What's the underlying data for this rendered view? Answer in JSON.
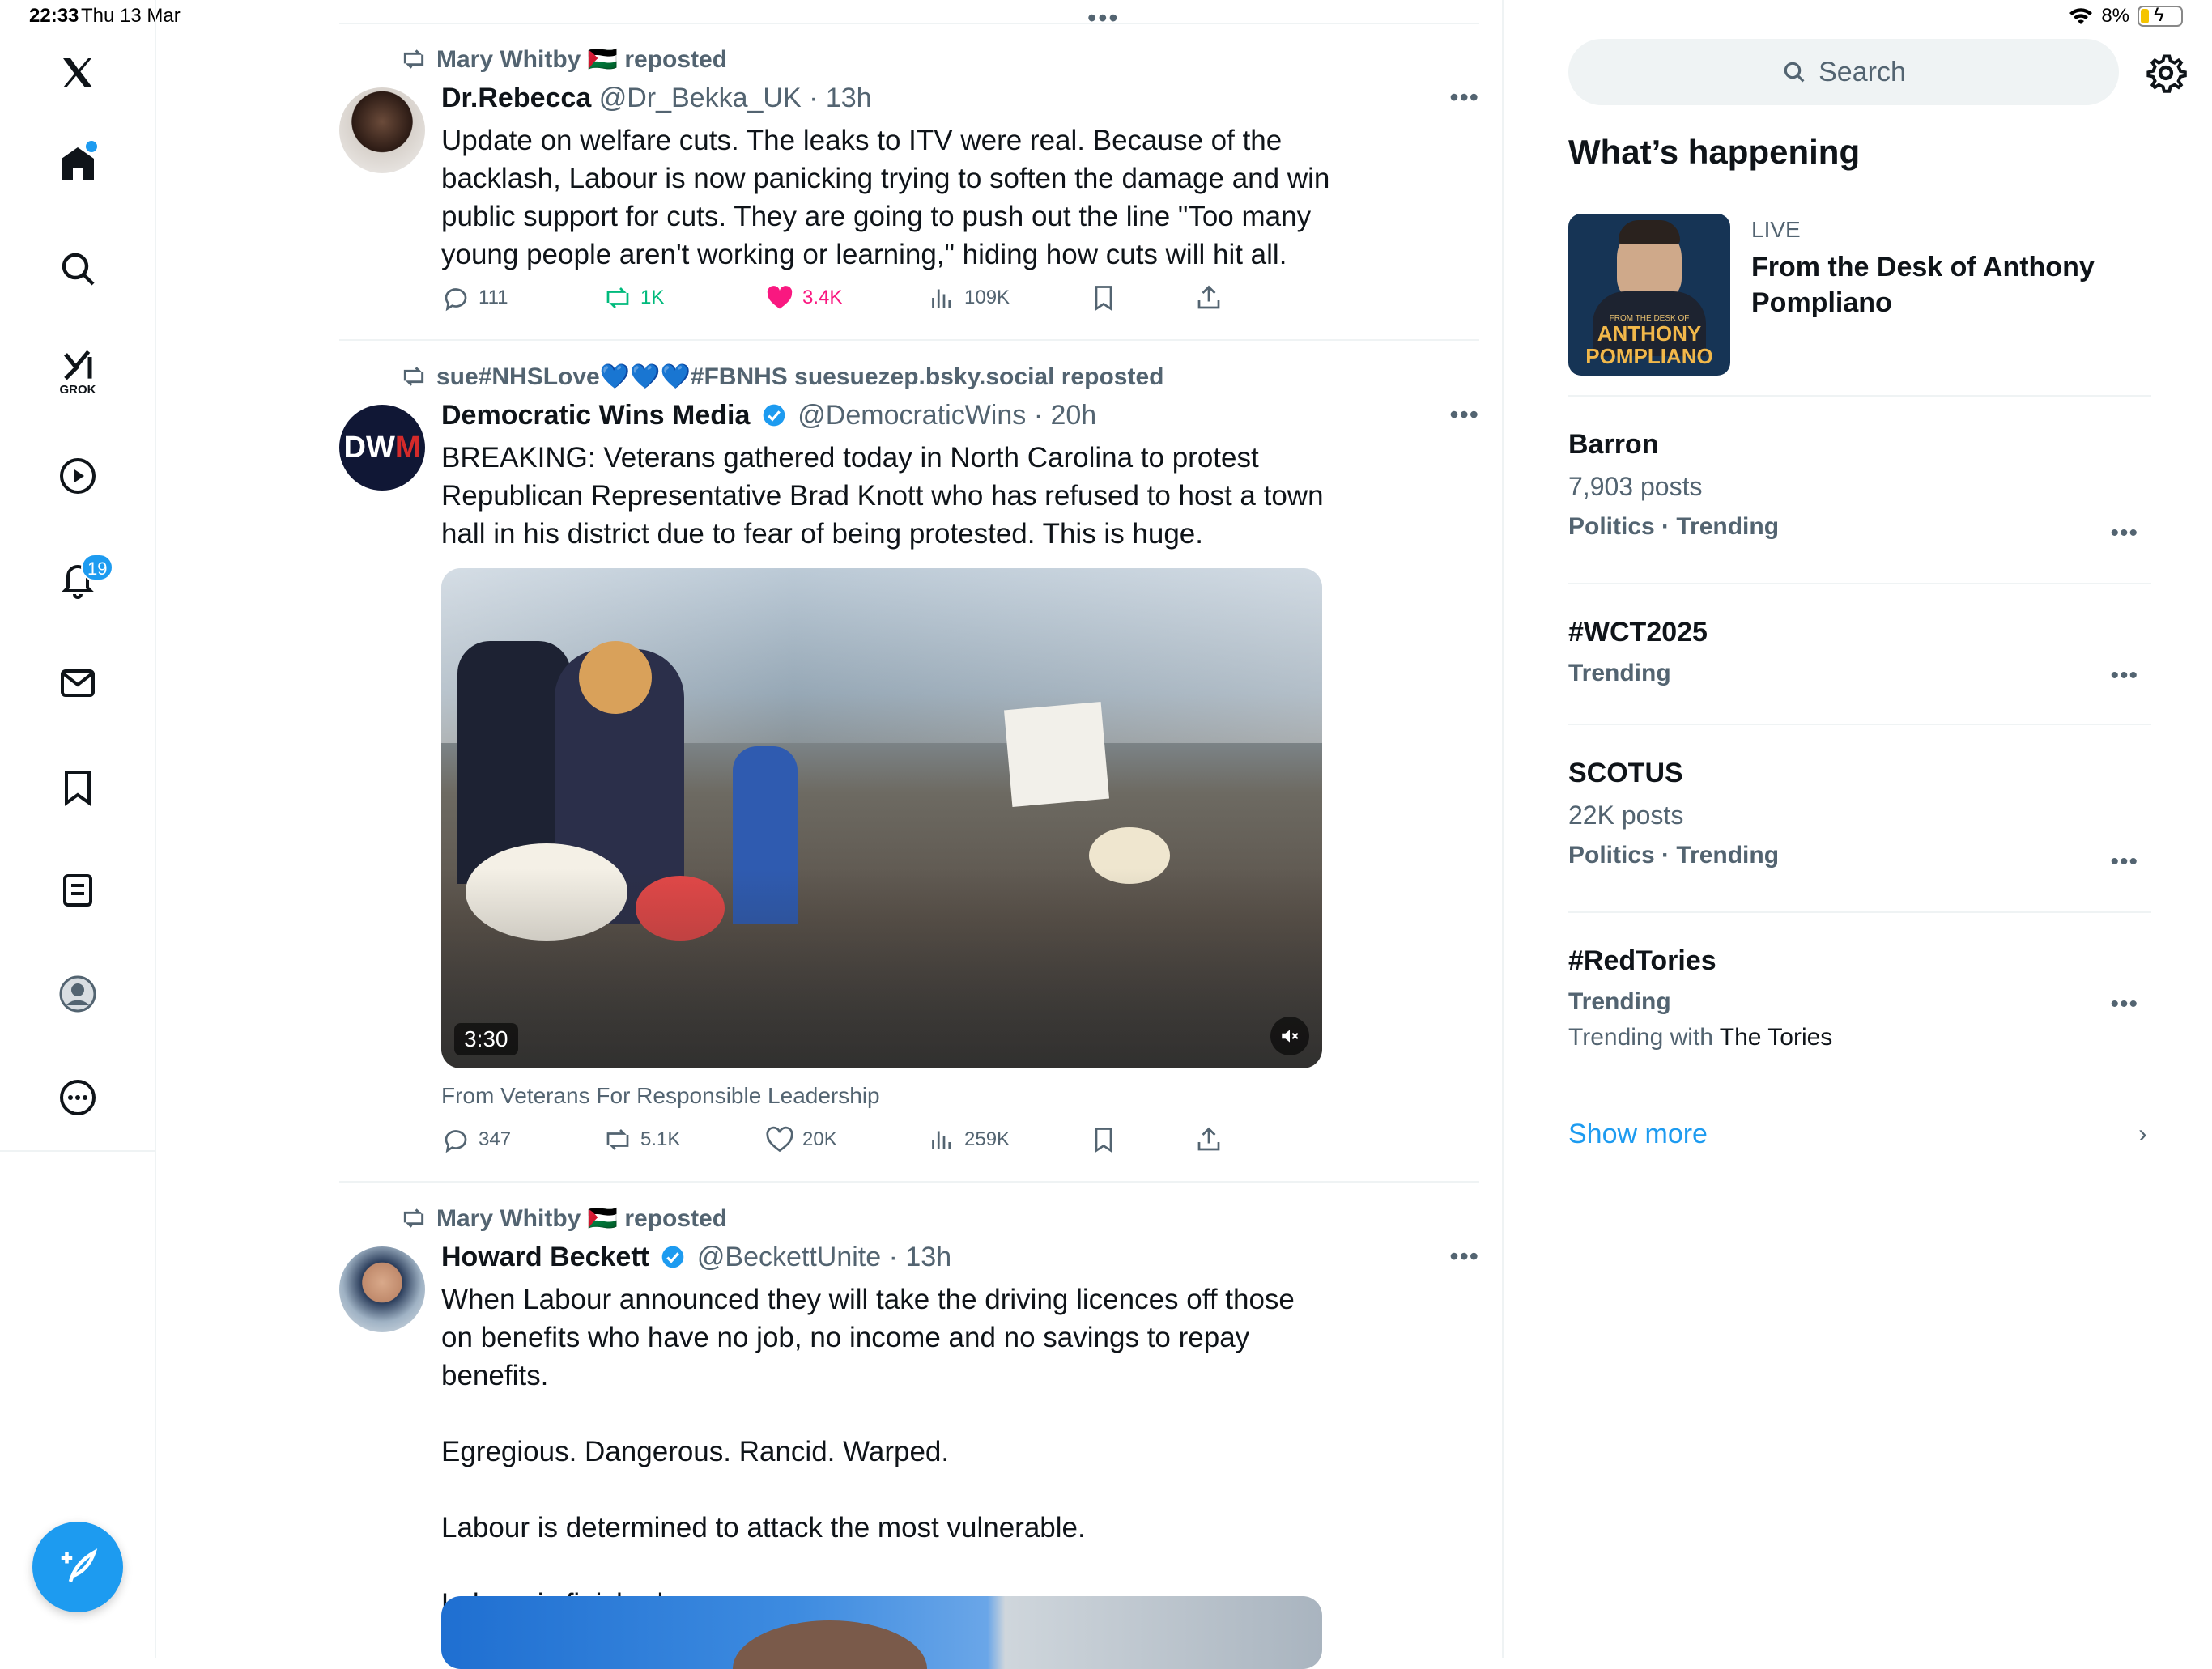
{
  "status_bar": {
    "time": "22:33",
    "date": "Thu 13 Mar",
    "battery": "8%"
  },
  "nav": {
    "notifications_badge": "19",
    "grok_label": "GROK"
  },
  "feed": {
    "tweets": [
      {
        "repost_by": "Mary Whitby 🇵🇸 reposted",
        "name": "Dr.Rebecca",
        "handle": "@Dr_Bekka_UK",
        "sep": " · ",
        "time": "13h",
        "text": "Update on welfare cuts. The leaks to ITV were real. Because of the backlash, Labour is now panicking trying to soften the damage and win public support for cuts. They are going to push out the line \"Too many young people aren't working or learning,\" hiding how cuts will hit all.",
        "replies": "111",
        "reposts": "1K",
        "likes": "3.4K",
        "views": "109K"
      },
      {
        "repost_by": "sue#NHSLove💙💙💙#FBNHS suesuezep.bsky.social reposted",
        "name": "Democratic Wins Media",
        "handle": "@DemocraticWins",
        "sep": " · ",
        "time": "20h",
        "text": "BREAKING: Veterans gathered today in North Carolina to protest Republican Representative Brad Knott who has refused to host a town hall in his district due to fear of being protested. This is huge.",
        "video_duration": "3:30",
        "from_line": "From Veterans For Responsible Leadership",
        "replies": "347",
        "reposts": "5.1K",
        "likes": "20K",
        "views": "259K"
      },
      {
        "repost_by": "Mary Whitby 🇵🇸 reposted",
        "name": "Howard Beckett",
        "handle": "@BeckettUnite",
        "sep": " · ",
        "time": "13h",
        "text": "When Labour announced they will take the driving licences off those on benefits who have no job, no income and no savings to repay benefits.\n\nEgregious. Dangerous. Rancid. Warped.\n\nLabour is determined to attack the most vulnerable.\n\nLabour is finished."
      }
    ]
  },
  "sidebar": {
    "search_placeholder": "Search",
    "whats_happening": "What’s happening",
    "live": {
      "label": "LIVE",
      "title": "From the Desk of Anthony Pompliano",
      "thumb_small": "FROM THE DESK OF",
      "thumb_line1": "ANTHONY",
      "thumb_line2": "POMPLIANO"
    },
    "trends": [
      {
        "name": "Barron",
        "posts": "7,903 posts",
        "category": "Politics · Trending"
      },
      {
        "name": "#WCT2025",
        "category": "Trending"
      },
      {
        "name": "SCOTUS",
        "posts": "22K posts",
        "category": "Politics · Trending"
      },
      {
        "name": "#RedTories",
        "category": "Trending",
        "with_prefix": "Trending with ",
        "with_name": "The Tories"
      }
    ],
    "show_more": "Show more"
  },
  "colors": {
    "accent": "#1d9bf0",
    "like_pink": "#f91880",
    "repost_green": "#00ba7c",
    "muted": "#536471"
  }
}
